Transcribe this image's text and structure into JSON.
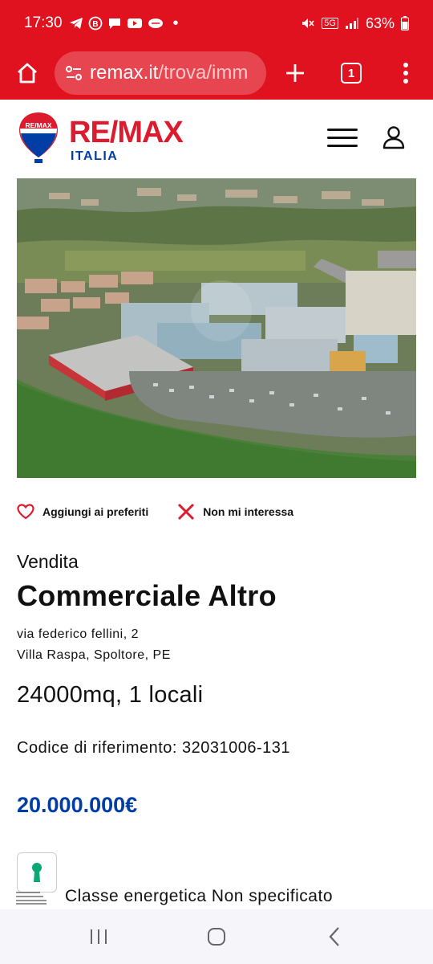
{
  "status_bar": {
    "time": "17:30",
    "battery": "63%",
    "network": "5G"
  },
  "browser": {
    "url_host": "remax.it",
    "url_path": "/trova/imm",
    "tab_count": "1"
  },
  "site": {
    "brand": "RE/MAX",
    "sub_brand": "ITALIA",
    "balloon_text": "RE/MAX",
    "brand_red": "#dc1c2e",
    "brand_blue": "#003da5"
  },
  "actions": {
    "favorite_label": "Aggiungi ai preferiti",
    "not_interested_label": "Non mi interessa"
  },
  "listing": {
    "contract": "Vendita",
    "title": "Commerciale Altro",
    "address_line1": "via federico fellini, 2",
    "address_line2": "Villa Raspa, Spoltore, PE",
    "size": "24000mq, 1 locali",
    "reference": "Codice di riferimento: 32031006-131",
    "price": "20.000.000€",
    "energy_class": "Classe energetica Non specificato"
  }
}
